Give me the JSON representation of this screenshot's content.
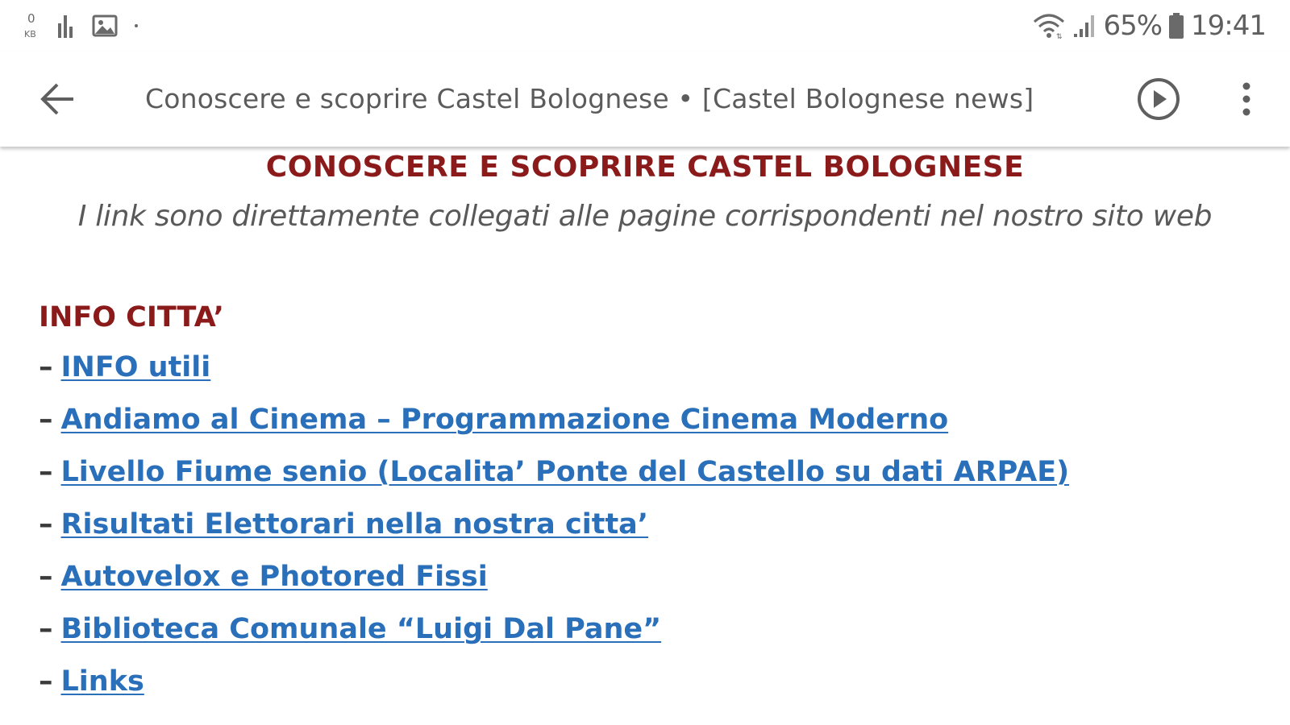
{
  "status_bar": {
    "battery_percent": "65%",
    "time": "19:41",
    "left_icons": [
      "data-usage-icon",
      "bar-chart-icon",
      "image-icon",
      "dot-icon"
    ],
    "right_icons": [
      "wifi-icon",
      "signal-icon",
      "battery-icon"
    ]
  },
  "app_bar": {
    "title": "Conoscere e scoprire Castel Bolognese • [Castel Bolognese news]",
    "back_icon": "arrow-left-icon",
    "play_icon": "play-circle-icon",
    "more_icon": "more-vert-icon"
  },
  "content": {
    "heading": "CONOSCERE E SCOPRIRE CASTEL BOLOGNESE",
    "subtitle": "I link sono direttamente collegati alle pagine corrispondenti nel nostro sito web",
    "section_title": "INFO CITTA’",
    "links": [
      {
        "dash": "–",
        "label": "INFO utili"
      },
      {
        "dash": "–",
        "label": "Andiamo al Cinema – Programmazione Cinema Moderno"
      },
      {
        "dash": "–",
        "label": "Livello Fiume senio (Localita’ Ponte del Castello su dati ARPAE)"
      },
      {
        "dash": "–",
        "label": "Risultati Elettorari nella nostra citta’"
      },
      {
        "dash": "–",
        "label": "Autovelox e Photored Fissi"
      },
      {
        "dash": "–",
        "label": "Biblioteca Comunale “Luigi Dal Pane”"
      },
      {
        "dash": "–",
        "label": "Links"
      }
    ]
  },
  "colors": {
    "heading": "#8b1a1a",
    "link": "#2a6fba",
    "subtitle": "#595959",
    "app_title": "#5b5b5b"
  }
}
